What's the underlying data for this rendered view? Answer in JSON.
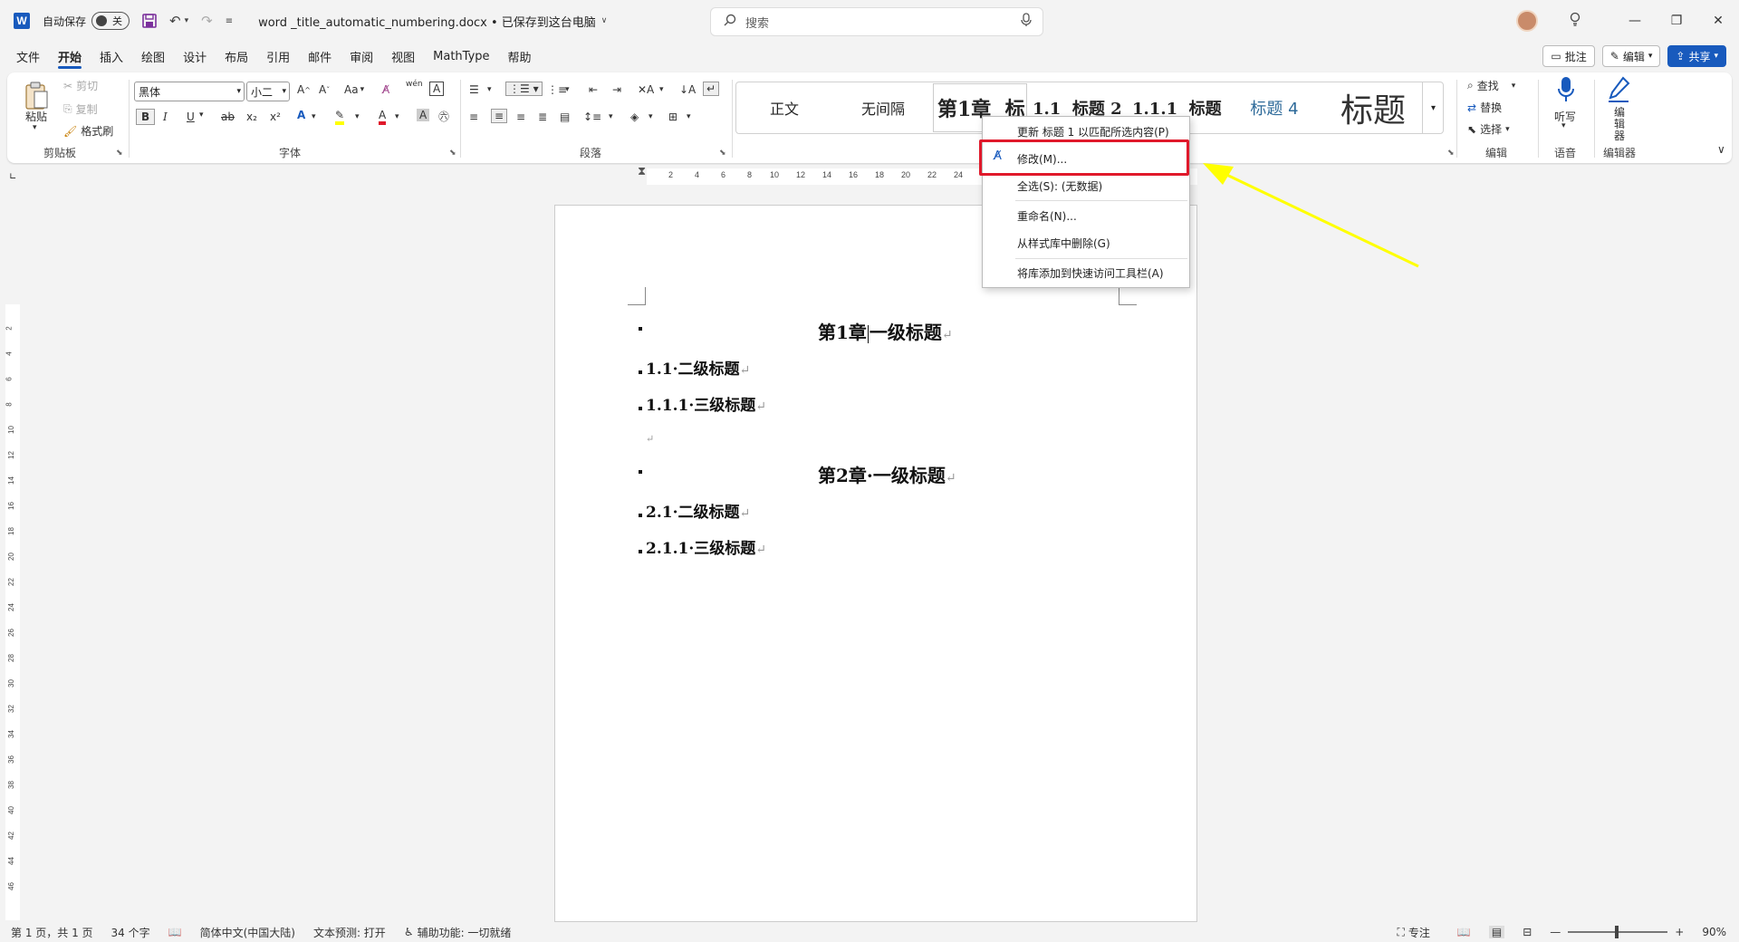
{
  "titlebar": {
    "app_icon": "W",
    "autosave_label": "自动保存",
    "autosave_state": "关",
    "filename": "word _title_automatic_numbering.docx • 已保存到这台电脑",
    "search_placeholder": "搜索"
  },
  "menu": {
    "tabs": [
      "文件",
      "开始",
      "插入",
      "绘图",
      "设计",
      "布局",
      "引用",
      "邮件",
      "审阅",
      "视图",
      "MathType",
      "帮助"
    ],
    "active_tab": "开始",
    "comment_label": "批注",
    "edit_label": "编辑",
    "share_label": "共享"
  },
  "ribbon": {
    "clipboard": {
      "paste": "粘贴",
      "cut": "剪切",
      "copy": "复制",
      "format_painter": "格式刷",
      "label": "剪贴板"
    },
    "font": {
      "font_name": "黑体",
      "font_size": "小二",
      "label": "字体",
      "aa": "Aa",
      "wen": "wén",
      "bold": "B",
      "italic": "I",
      "underline": "U",
      "strike": "ab",
      "sub": "x₂",
      "sup": "x²"
    },
    "paragraph": {
      "label": "段落"
    },
    "styles": {
      "items": [
        {
          "label": "正文"
        },
        {
          "label": "无间隔"
        },
        {
          "label": "第1章  标"
        },
        {
          "label": "1.1  标题 2"
        },
        {
          "label": "1.1.1  标题"
        },
        {
          "label": "标题 4"
        },
        {
          "label": "标题"
        }
      ]
    },
    "editing": {
      "find": "查找",
      "replace": "替换",
      "select": "选择",
      "label": "编辑"
    },
    "voice": {
      "dictate": "听写",
      "label": "语音"
    },
    "editor": {
      "name": "编辑器",
      "label": "编辑器"
    }
  },
  "ruler": {
    "ticks": [
      "2",
      "4",
      "6",
      "8",
      "10",
      "12",
      "14",
      "16",
      "18",
      "20",
      "22",
      "24"
    ],
    "vticks": [
      "2",
      "4",
      "6",
      "8",
      "10",
      "12",
      "14",
      "16",
      "18",
      "20",
      "22",
      "24",
      "26",
      "28",
      "30",
      "32",
      "34",
      "36",
      "38",
      "40",
      "42",
      "44",
      "46"
    ]
  },
  "document": {
    "h1_a_pre": "第1章",
    "h1_a_post": "一级标题",
    "h2_a": "1.1·二级标题",
    "h3_a": "1.1.1·三级标题",
    "h1_b": "第2章·一级标题",
    "h2_b": "2.1·二级标题",
    "h3_b": "2.1.1·三级标题",
    "para_mark": "↵"
  },
  "context_menu": {
    "items": [
      "更新 标题 1 以匹配所选内容(P)",
      "修改(M)...",
      "全选(S): (无数据)",
      "重命名(N)...",
      "从样式库中删除(G)",
      "将库添加到快速访问工具栏(A)"
    ]
  },
  "statusbar": {
    "page": "第 1 页，共 1 页",
    "words": "34 个字",
    "language": "简体中文(中国大陆)",
    "prediction": "文本预测: 打开",
    "accessibility": "辅助功能: 一切就绪",
    "focus": "专注",
    "zoom": "90%"
  },
  "colors": {
    "accent": "#185abd",
    "highlight_red": "#e0192b",
    "arrow_yellow": "#ffff00"
  }
}
